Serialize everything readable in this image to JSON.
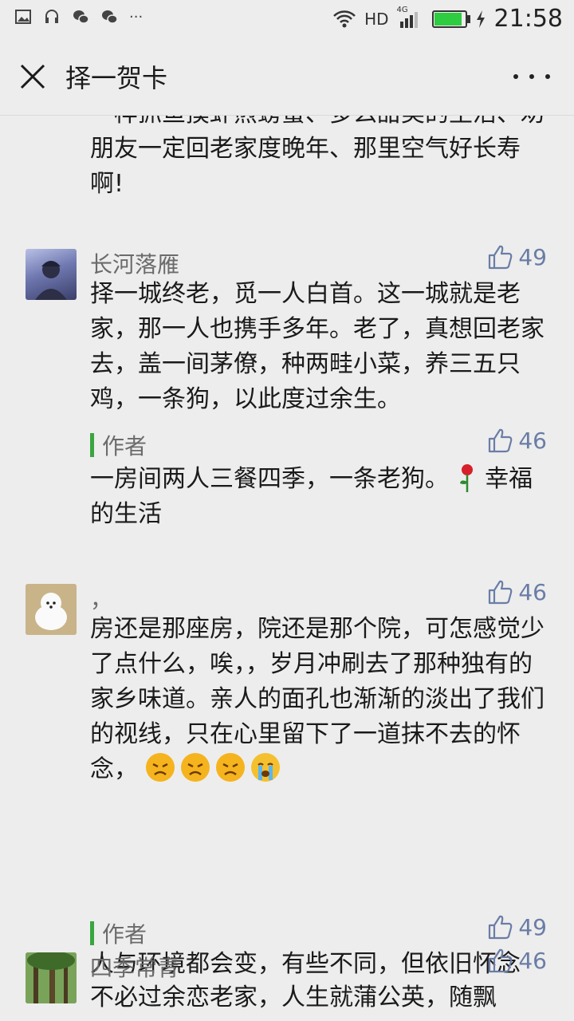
{
  "status_bar": {
    "network": "HD",
    "signal_type": "4G",
    "time": "21:58"
  },
  "header": {
    "title": "择一贺卡"
  },
  "comments": [
    {
      "text": "一样抓鱼摸虾煎螃蟹、多么甜美的生活、劝朋友一定回老家度晚年、那里空气好长寿啊!"
    },
    {
      "name": "长河落雁",
      "likes": "49",
      "text": "择一城终老，觅一人白首。这一城就是老家，那一人也携手多年。老了，真想回老家去，盖一间茅僚，种两畦小菜，养三五只鸡，一条狗，以此度过余生。",
      "reply": {
        "author": "作者",
        "likes": "46",
        "text": "一房间两人三餐四季，一条老狗。",
        "emoji": "rose-emoji",
        "text_after": "幸福的生活"
      }
    },
    {
      "name": "，",
      "likes": "46",
      "text": "房还是那座房，院还是那个院，可怎感觉少了点什么，唉，，岁月冲刷去了那种独有的家乡味道。亲人的面孔也渐渐的淡出了我们的视线，只在心里留下了一道抹不去的怀念，",
      "emojis": [
        "angry-face-emoji",
        "angry-face-emoji",
        "angry-face-emoji",
        "crying-face-emoji"
      ],
      "reply": {
        "author": "作者",
        "likes": "49",
        "text": "人与环境都会变，有些不同，但依旧怀念"
      }
    },
    {
      "name": "四季常青",
      "likes": "46",
      "text": "不必过余恋老家，人生就蒲公英，随飘"
    }
  ],
  "colors": {
    "background": "#ededed",
    "like_blue": "#6a7da6",
    "author_green": "#3aa640"
  }
}
